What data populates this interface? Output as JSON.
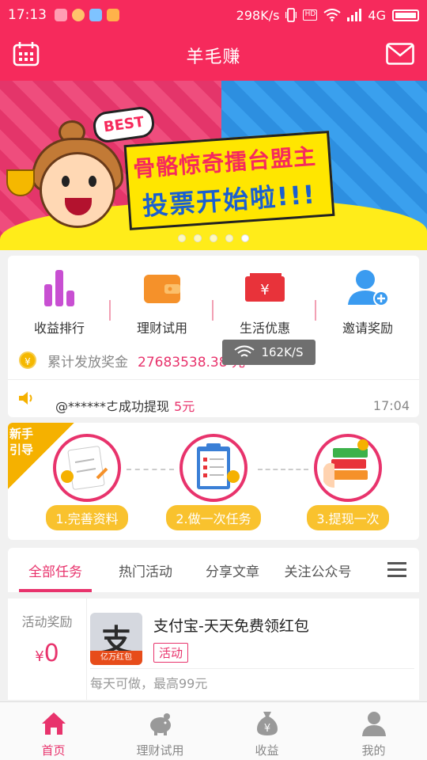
{
  "status_bar": {
    "time": "17:13",
    "net_speed": "298K/s",
    "hd": "HD",
    "network": "4G"
  },
  "header": {
    "title": "羊毛赚"
  },
  "banner": {
    "best": "BEST",
    "line1": "骨骼惊奇擂台盟主",
    "line2": "投票开始啦!!!",
    "active_dot": 5,
    "dot_count": 5
  },
  "menu": {
    "items": [
      {
        "label": "收益排行",
        "icon": "bar-chart-icon",
        "color": "#c84fd2"
      },
      {
        "label": "理财试用",
        "icon": "wallet-icon",
        "color": "#f5912a"
      },
      {
        "label": "生活优惠",
        "icon": "ticket-icon",
        "color": "#e8333a"
      },
      {
        "label": "邀请奖励",
        "icon": "add-user-icon",
        "color": "#3a9bf0"
      }
    ],
    "stat_label": "累计发放奖金",
    "stat_value": "27683538.38 元",
    "notice_user": "@******ㄜ成功提现",
    "notice_amount": "5元",
    "notice_time": "17:04"
  },
  "toast": {
    "speed": "162K/S"
  },
  "guide": {
    "ribbon": [
      "新手",
      "引导"
    ],
    "steps": [
      {
        "label": "1.完善资料",
        "badge": "资料"
      },
      {
        "label": "2.做一次任务",
        "badge": "任务"
      },
      {
        "label": "3.提现一次",
        "badge": "现金"
      }
    ]
  },
  "tabs": {
    "items": [
      "全部任务",
      "热门活动",
      "分享文章",
      "关注公众号"
    ],
    "active": 0
  },
  "task": {
    "reward_label": "活动奖励",
    "currency": "¥",
    "reward_value": "0",
    "logo_char": "支",
    "logo_strip": "亿万红包",
    "title": "支付宝-天天免费领红包",
    "tag": "活动",
    "desc": "每天可做，最高99元"
  },
  "bottom_nav": {
    "items": [
      {
        "label": "首页",
        "icon": "home-icon"
      },
      {
        "label": "理财试用",
        "icon": "piggy-bank-icon"
      },
      {
        "label": "收益",
        "icon": "money-bag-icon"
      },
      {
        "label": "我的",
        "icon": "profile-icon"
      }
    ],
    "active": 0
  },
  "colors": {
    "primary": "#f62a5c",
    "accent_pink": "#e8336c",
    "gold": "#f5b100"
  }
}
